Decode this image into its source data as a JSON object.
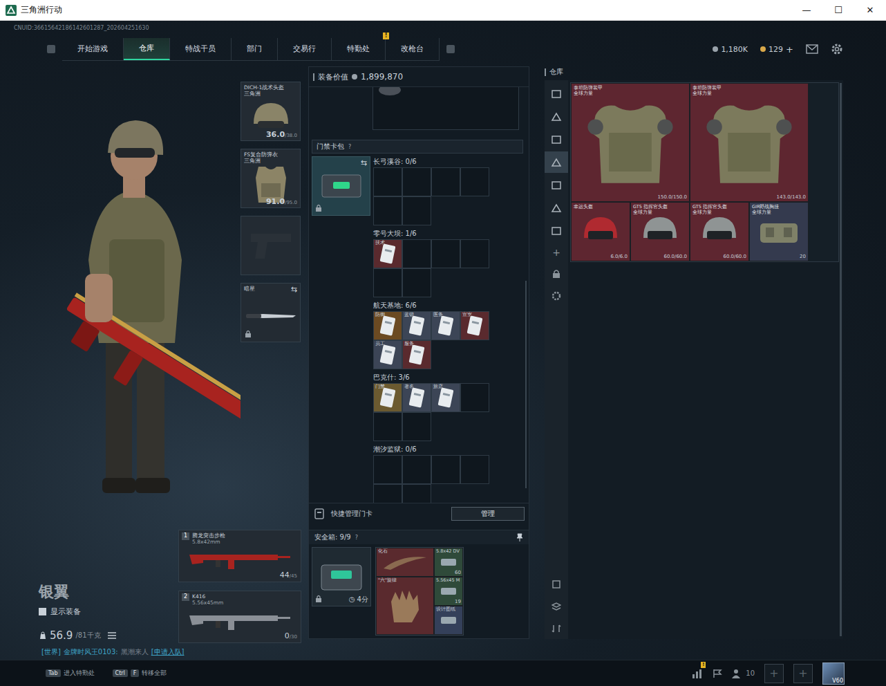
{
  "window": {
    "title": "三角洲行动",
    "controls": [
      "—",
      "☐",
      "✕"
    ]
  },
  "uid": "CNUID:36615642186142601287_202604251630",
  "nav": {
    "tabs": [
      {
        "label": "开始游戏",
        "selected": false
      },
      {
        "label": "仓库",
        "selected": true
      },
      {
        "label": "特战干员",
        "selected": false
      },
      {
        "label": "部门",
        "selected": false
      },
      {
        "label": "交易行",
        "selected": false
      },
      {
        "label": "特勤处",
        "selected": false,
        "badge": "!"
      },
      {
        "label": "改枪台",
        "selected": false
      }
    ]
  },
  "currency": [
    {
      "kind": "coin",
      "value": "1,180K"
    },
    {
      "kind": "bond",
      "value": "129",
      "plus": "+"
    }
  ],
  "player": {
    "name": "银翼",
    "show_equipment": {
      "label": "显示装备",
      "checked": false
    },
    "weight": {
      "value": "56.9",
      "max": "/81千克"
    }
  },
  "chat": {
    "channel": "[世界]",
    "sender": "金牌时风王0103:",
    "message": "黑潮来人",
    "action": "[申请入队]"
  },
  "equipment": [
    {
      "kind": "helmet",
      "name": "DICH-1战术头盔",
      "sub": "三角洲",
      "value": "36.0",
      "max": "/38.0",
      "locked": false
    },
    {
      "kind": "armor",
      "name": "FS复合防弹衣",
      "sub": "三角洲",
      "value": "91.0",
      "max": "/95.0",
      "locked": false
    },
    {
      "kind": "pistol",
      "locked": false
    },
    {
      "kind": "knife",
      "name": "暗星",
      "swap": "⇆",
      "locked": true
    }
  ],
  "weapons": [
    {
      "index": "1",
      "name": "腾龙突击步枪",
      "caliber": "5.8x42mm",
      "ammo": "44",
      "max": "/45",
      "color": "#a8231f"
    },
    {
      "index": "2",
      "name": "K416",
      "caliber": "5.56x45mm",
      "ammo": "0",
      "max": "/30",
      "color": "#8a8f96"
    }
  ],
  "equipment_value": {
    "label": "装备价值",
    "value": "1,899,870"
  },
  "keycard_pack": {
    "title": "门禁卡包",
    "help": "?",
    "swap": "⇆",
    "locked": true
  },
  "maps": [
    {
      "name": "长弓溪谷: 0/6",
      "cards": []
    },
    {
      "name": "零号大坝: 1/6",
      "cards": [
        {
          "label": "技术",
          "color": "#5a2a2e"
        }
      ]
    },
    {
      "name": "航天基地: 6/6",
      "cards": [
        {
          "label": "防御",
          "color": "#6b4a22"
        },
        {
          "label": "蓝锁",
          "color": "#3c4556"
        },
        {
          "label": "医务",
          "color": "#3c4556"
        },
        {
          "label": "宣室",
          "color": "#5a2a2e"
        },
        {
          "label": "员工",
          "color": "#3c4556"
        },
        {
          "label": "服务",
          "color": "#5a2a2e"
        }
      ]
    },
    {
      "name": "巴克什: 3/6",
      "cards": [
        {
          "label": "门禁",
          "color": "#6b5a30"
        },
        {
          "label": "著名",
          "color": "#3c4556"
        },
        {
          "label": "旅店",
          "color": "#3c4556"
        }
      ]
    },
    {
      "name": "潮汐监狱: 0/6",
      "cards": []
    }
  ],
  "quick_manage": {
    "label": "快捷管理门卡",
    "button": "管理"
  },
  "safebox": {
    "title": "安全箱: 9/9",
    "help": "?",
    "timer": "4分",
    "locked": true,
    "items": [
      {
        "kind": "wide",
        "name": "化石",
        "color": "#5a2a2e"
      },
      {
        "kind": "small",
        "name": "5.8x42 DV",
        "count": "60",
        "color": "#2f4a3a"
      },
      {
        "kind": "big",
        "name": "\"六\"旋律",
        "color": "#5a2a2e"
      },
      {
        "kind": "small",
        "name": "5.56x45 M",
        "count": "19",
        "color": "#2f4a3a"
      },
      {
        "kind": "small",
        "name": "设计图纸",
        "color": "#34405a"
      }
    ]
  },
  "warehouse": {
    "title": "仓库",
    "tabs": [
      {
        "selected": false
      },
      {
        "selected": false
      },
      {
        "selected": false
      },
      {
        "selected": true
      },
      {
        "selected": false
      },
      {
        "selected": false
      },
      {
        "selected": false
      }
    ],
    "add": "+",
    "items": [
      {
        "kind": "armor",
        "name": "泰坦防弹装甲",
        "sub": "全球力量",
        "value": "150.0/150.0",
        "color": "#5e2630"
      },
      {
        "kind": "armor",
        "name": "泰坦防弹装甲",
        "sub": "全球力量",
        "value": "143.0/143.0",
        "color": "#5e2630"
      },
      {
        "kind": "helmet",
        "name": "幸运头盔",
        "value": "6.0/6.0",
        "color": "#5e2630"
      },
      {
        "kind": "helmet",
        "name": "GT5 指挥官头盔",
        "sub": "全球力量",
        "value": "60.0/60.0",
        "color": "#5e2630"
      },
      {
        "kind": "helmet",
        "name": "GT5 指挥官头盔",
        "sub": "全球力量",
        "value": "60.0/60.0",
        "color": "#5e2630"
      },
      {
        "kind": "rig",
        "name": "GIR野战胸挂",
        "sub": "全球力量",
        "value": "20",
        "color": "#343a4e"
      }
    ]
  },
  "bottom_hints": [
    {
      "keys": [
        "Tab"
      ],
      "label": "进入特勤处"
    },
    {
      "keys": [
        "Ctrl",
        "F"
      ],
      "label": "转移全部"
    }
  ],
  "social": {
    "chart_badge": "!",
    "friends": "10",
    "slots": [
      "+",
      "+"
    ],
    "level": "V60"
  }
}
